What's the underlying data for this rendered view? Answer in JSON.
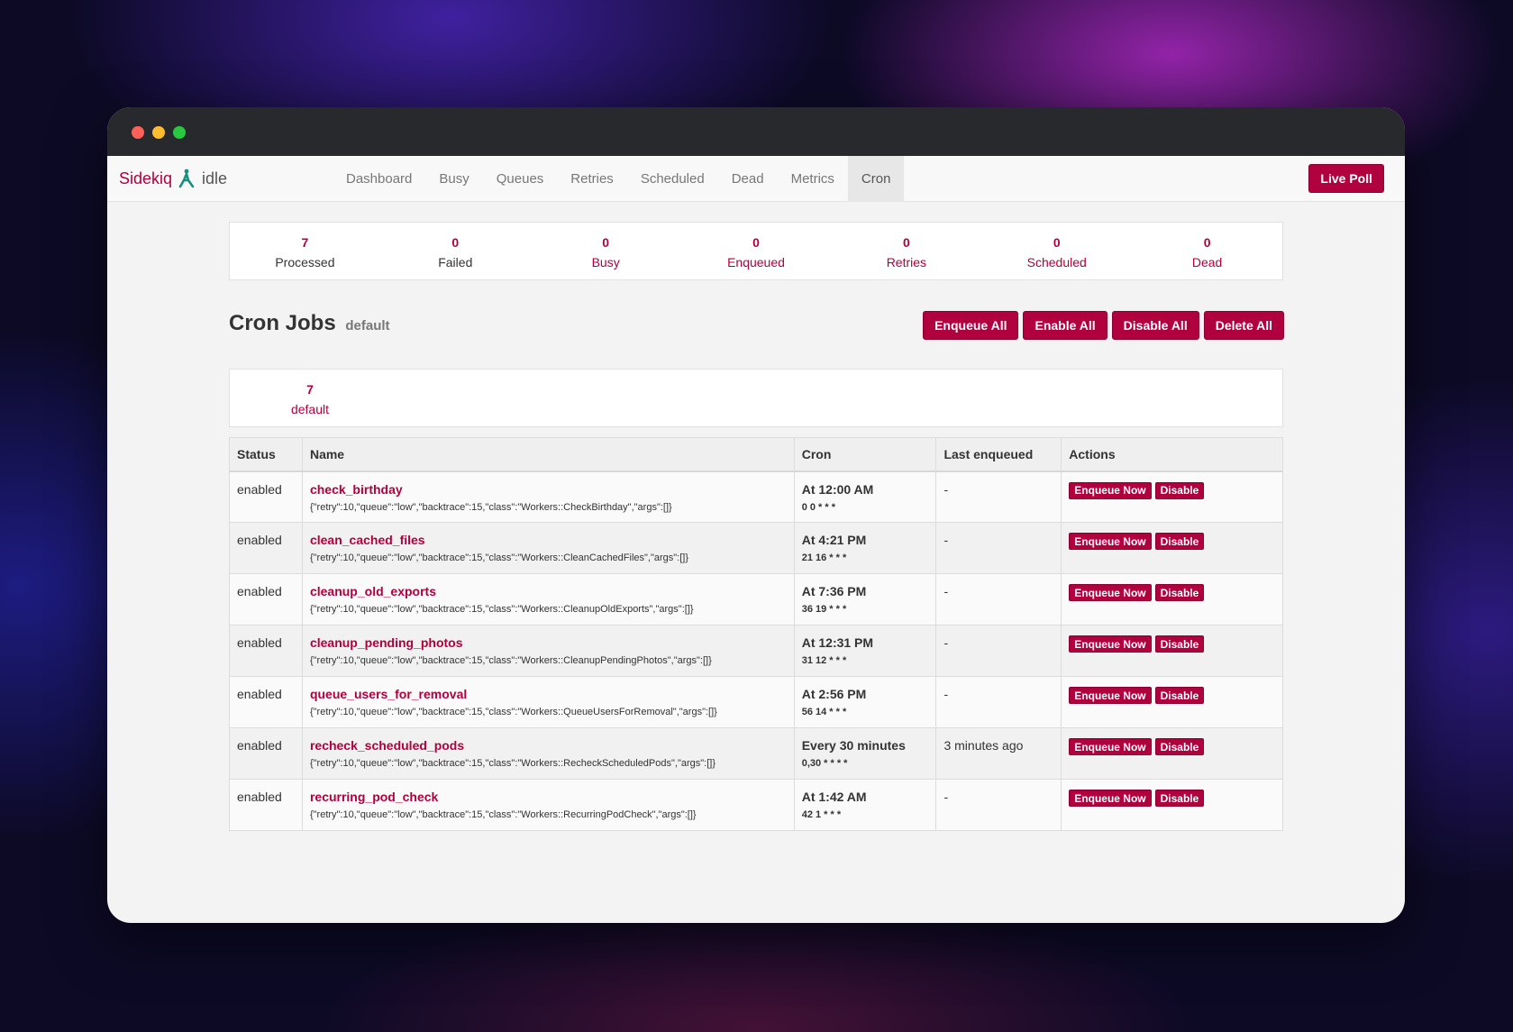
{
  "window": {
    "controls": [
      "close",
      "minimize",
      "zoom"
    ]
  },
  "navbar": {
    "brand": "Sidekiq",
    "brand_icon": "sidekiq-logo-icon",
    "status": "idle",
    "items": [
      {
        "label": "Dashboard"
      },
      {
        "label": "Busy"
      },
      {
        "label": "Queues"
      },
      {
        "label": "Retries"
      },
      {
        "label": "Scheduled"
      },
      {
        "label": "Dead"
      },
      {
        "label": "Metrics"
      },
      {
        "label": "Cron",
        "active": true
      }
    ],
    "live_poll": "Live Poll"
  },
  "summary": [
    {
      "count": "7",
      "label": "Processed"
    },
    {
      "count": "0",
      "label": "Failed"
    },
    {
      "count": "0",
      "label": "Busy"
    },
    {
      "count": "0",
      "label": "Enqueued"
    },
    {
      "count": "0",
      "label": "Retries"
    },
    {
      "count": "0",
      "label": "Scheduled"
    },
    {
      "count": "0",
      "label": "Dead"
    }
  ],
  "page": {
    "title": "Cron Jobs",
    "namespace": "default",
    "bulk_actions": {
      "enqueue_all": "Enqueue All",
      "enable_all": "Enable All",
      "disable_all": "Disable All",
      "delete_all": "Delete All"
    }
  },
  "namespaces": [
    {
      "count": "7",
      "name": "default"
    }
  ],
  "table": {
    "headers": {
      "status": "Status",
      "name": "Name",
      "cron": "Cron",
      "last": "Last enqueued",
      "actions": "Actions"
    },
    "action_labels": {
      "enqueue": "Enqueue Now",
      "disable": "Disable"
    },
    "rows": [
      {
        "status": "enabled",
        "name": "check_birthday",
        "args": "{\"retry\":10,\"queue\":\"low\",\"backtrace\":15,\"class\":\"Workers::CheckBirthday\",\"args\":[]}",
        "cron_human": "At 12:00 AM",
        "cron_expr": "0 0 * * *",
        "last": "-"
      },
      {
        "status": "enabled",
        "name": "clean_cached_files",
        "args": "{\"retry\":10,\"queue\":\"low\",\"backtrace\":15,\"class\":\"Workers::CleanCachedFiles\",\"args\":[]}",
        "cron_human": "At 4:21 PM",
        "cron_expr": "21 16 * * *",
        "last": "-"
      },
      {
        "status": "enabled",
        "name": "cleanup_old_exports",
        "args": "{\"retry\":10,\"queue\":\"low\",\"backtrace\":15,\"class\":\"Workers::CleanupOldExports\",\"args\":[]}",
        "cron_human": "At 7:36 PM",
        "cron_expr": "36 19 * * *",
        "last": "-"
      },
      {
        "status": "enabled",
        "name": "cleanup_pending_photos",
        "args": "{\"retry\":10,\"queue\":\"low\",\"backtrace\":15,\"class\":\"Workers::CleanupPendingPhotos\",\"args\":[]}",
        "cron_human": "At 12:31 PM",
        "cron_expr": "31 12 * * *",
        "last": "-"
      },
      {
        "status": "enabled",
        "name": "queue_users_for_removal",
        "args": "{\"retry\":10,\"queue\":\"low\",\"backtrace\":15,\"class\":\"Workers::QueueUsersForRemoval\",\"args\":[]}",
        "cron_human": "At 2:56 PM",
        "cron_expr": "56 14 * * *",
        "last": "-"
      },
      {
        "status": "enabled",
        "name": "recheck_scheduled_pods",
        "args": "{\"retry\":10,\"queue\":\"low\",\"backtrace\":15,\"class\":\"Workers::RecheckScheduledPods\",\"args\":[]}",
        "cron_human": "Every 30 minutes",
        "cron_expr": "0,30 * * * *",
        "last": "3 minutes ago"
      },
      {
        "status": "enabled",
        "name": "recurring_pod_check",
        "args": "{\"retry\":10,\"queue\":\"low\",\"backtrace\":15,\"class\":\"Workers::RecurringPodCheck\",\"args\":[]}",
        "cron_human": "At 1:42 AM",
        "cron_expr": "42 1 * * *",
        "last": "-"
      }
    ]
  },
  "colors": {
    "accent": "#b1003e",
    "nav_bg": "#f8f8f8",
    "page_bg": "#f3f3f3",
    "titlebar": "#28292d"
  }
}
